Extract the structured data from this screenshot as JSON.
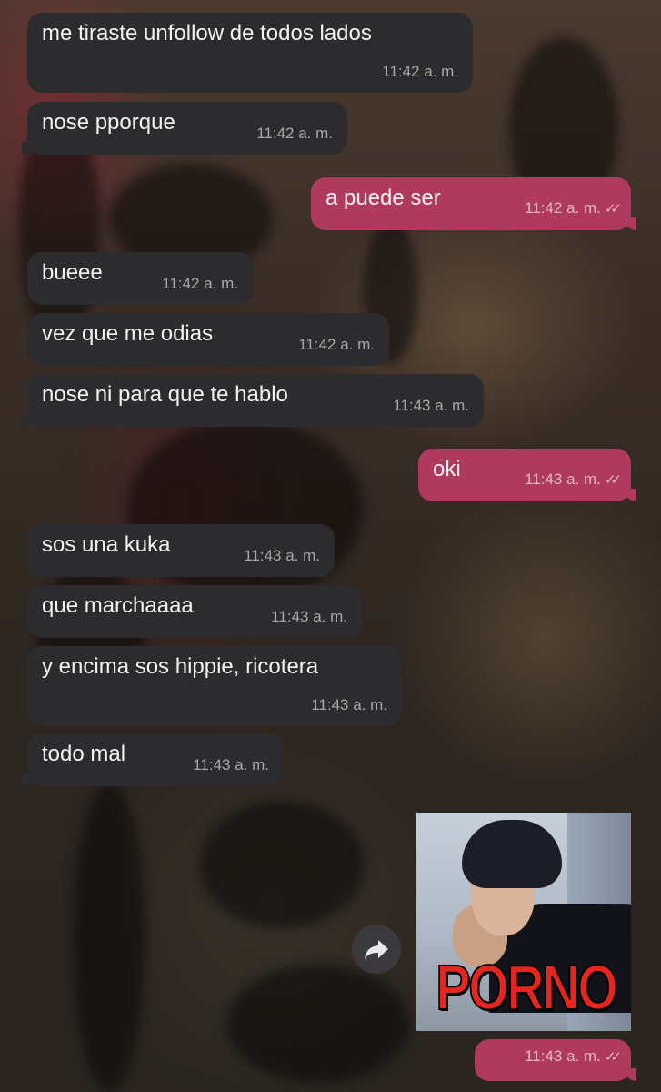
{
  "chat": {
    "messages": [
      {
        "text": "me tiraste unfollow de todos lados",
        "time": "11:42 a. m.",
        "direction": "in"
      },
      {
        "text": "nose pporque",
        "time": "11:42 a. m.",
        "direction": "in"
      },
      {
        "text": "a puede ser",
        "time": "11:42 a. m.",
        "direction": "out"
      },
      {
        "text": "bueee",
        "time": "11:42 a. m.",
        "direction": "in"
      },
      {
        "text": "vez que me odias",
        "time": "11:42 a. m.",
        "direction": "in"
      },
      {
        "text": "nose ni para que te hablo",
        "time": "11:43 a. m.",
        "direction": "in"
      },
      {
        "text": "oki",
        "time": "11:43 a. m.",
        "direction": "out"
      },
      {
        "text": "sos una kuka",
        "time": "11:43 a. m.",
        "direction": "in"
      },
      {
        "text": "que marchaaaa",
        "time": "11:43 a. m.",
        "direction": "in"
      },
      {
        "text": "y encima sos hippie, ricotera",
        "time": "11:43 a. m.",
        "direction": "in"
      },
      {
        "text": "todo mal",
        "time": "11:43 a. m.",
        "direction": "in"
      }
    ],
    "image_message": {
      "caption_text": "PORNO",
      "time": "11:43 a. m.",
      "direction": "out",
      "icon": "forward-icon"
    },
    "read_receipt_glyph": "✓✓"
  },
  "colors": {
    "incoming_bubble": "#2c2c2e",
    "outgoing_bubble": "#b03a5e",
    "text": "#f2f2f2"
  }
}
